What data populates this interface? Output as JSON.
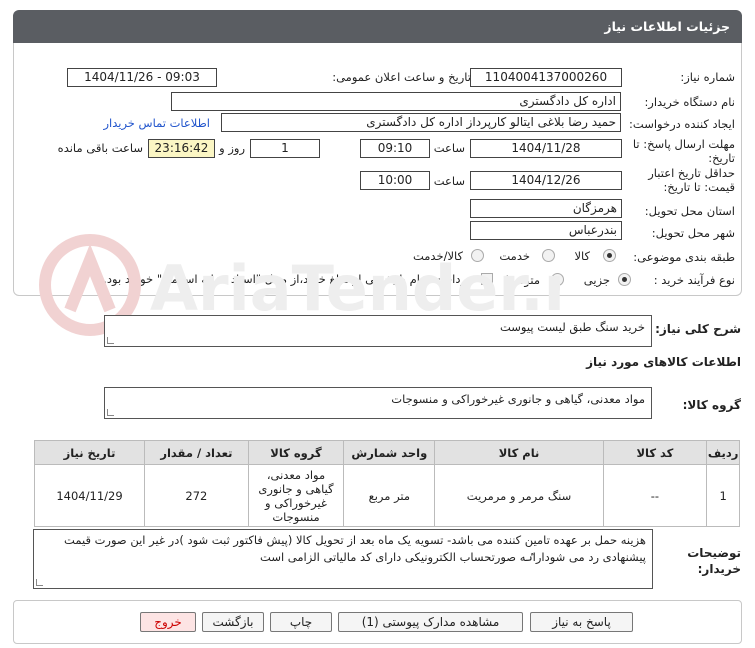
{
  "header": {
    "title": "جزئیات اطلاعات نیاز"
  },
  "form": {
    "need_number_label": "شماره نیاز:",
    "need_number": "1104004137000260",
    "announce_label": "تاریخ و ساعت اعلان عمومی:",
    "announce_value": "1404/11/26 - 09:03",
    "buyer_org_label": "نام دستگاه خریدار:",
    "buyer_org": "اداره کل دادگستری",
    "requester_label": "ایجاد کننده درخواست:",
    "requester": "حمید رضا  بلاغی ایتالو کارپرداز اداره کل دادگستری",
    "contact_link": "اطلاعات تماس خریدار",
    "deadline_label_1": "مهلت ارسال پاسخ: تا",
    "deadline_label_2": "تاریخ:",
    "deadline_date": "1404/11/28",
    "time_label": "ساعت",
    "deadline_time": "09:10",
    "days_value": "1",
    "days_label": "روز و",
    "remaining_value": "23:16:42",
    "remaining_label": "ساعت باقی مانده",
    "validity_label_1": "حداقل تاریخ اعتبار",
    "validity_label_2": "قیمت: تا تاریخ:",
    "validity_date": "1404/12/26",
    "validity_time_label": "ساعت",
    "validity_time": "10:00",
    "province_label": "استان محل تحویل:",
    "province": "هرمزگان",
    "city_label": "شهر محل تحویل:",
    "city": "بندرعباس",
    "category_label": "طبقه بندی موضوعی:",
    "category_options": [
      "کالا",
      "خدمت",
      "کالا/خدمت"
    ],
    "process_label": "نوع فرآیند خرید :",
    "process_options": [
      "جزیی",
      "متوسط"
    ],
    "payment_note": "پرداخت تمام یا بخشی از مبلغ خرید،از محل \"اسناد خزانه اسلامی\" خواهد بود."
  },
  "description": {
    "label": "شرح کلی نیاز:",
    "value": "خرید سنگ طبق لیست پیوست"
  },
  "goods": {
    "section_title": "اطلاعات کالاهای مورد نیاز",
    "group_label": "گروه کالا:",
    "group_value": "مواد معدنی، گیاهی و جانوری غیرخوراکی و منسوجات",
    "columns": [
      "ردیف",
      "کد کالا",
      "نام کالا",
      "واحد شمارش",
      "گروه کالا",
      "تعداد / مقدار",
      "تاریخ نیاز"
    ],
    "rows": [
      [
        "1",
        "--",
        "سنگ مرمر و مرمریت",
        "متر مربع",
        "مواد معدنی، گیاهی و جانوری غیرخوراکی و منسوجات",
        "272",
        "1404/11/29"
      ]
    ]
  },
  "buyer_notes": {
    "label_1": "توضیحات",
    "label_2": "خریدار:",
    "value": "هزینه حمل بر عهده تامین کننده می باشد- تسویه یک ماه بعد از تحویل کالا (پیش فاکتور ثبت شود )در غیر این صورت قیمت پیشنهادی رد می شوداراٸه صورتحساب الکترونیکی دارای کد مالیاتی الزامی است"
  },
  "buttons": {
    "reply": "پاسخ به نیاز",
    "attachments": "مشاهده مدارک پیوستی (1)",
    "print": "چاپ",
    "back": "بازگشت",
    "exit": "خروج"
  },
  "watermark": {
    "text": "AriaTender.neT"
  },
  "colors": {
    "titlebar": "#5a5d62",
    "link": "#2255cc",
    "remaining_bg": "#fbf6c4",
    "exit_text": "#cc0000"
  }
}
